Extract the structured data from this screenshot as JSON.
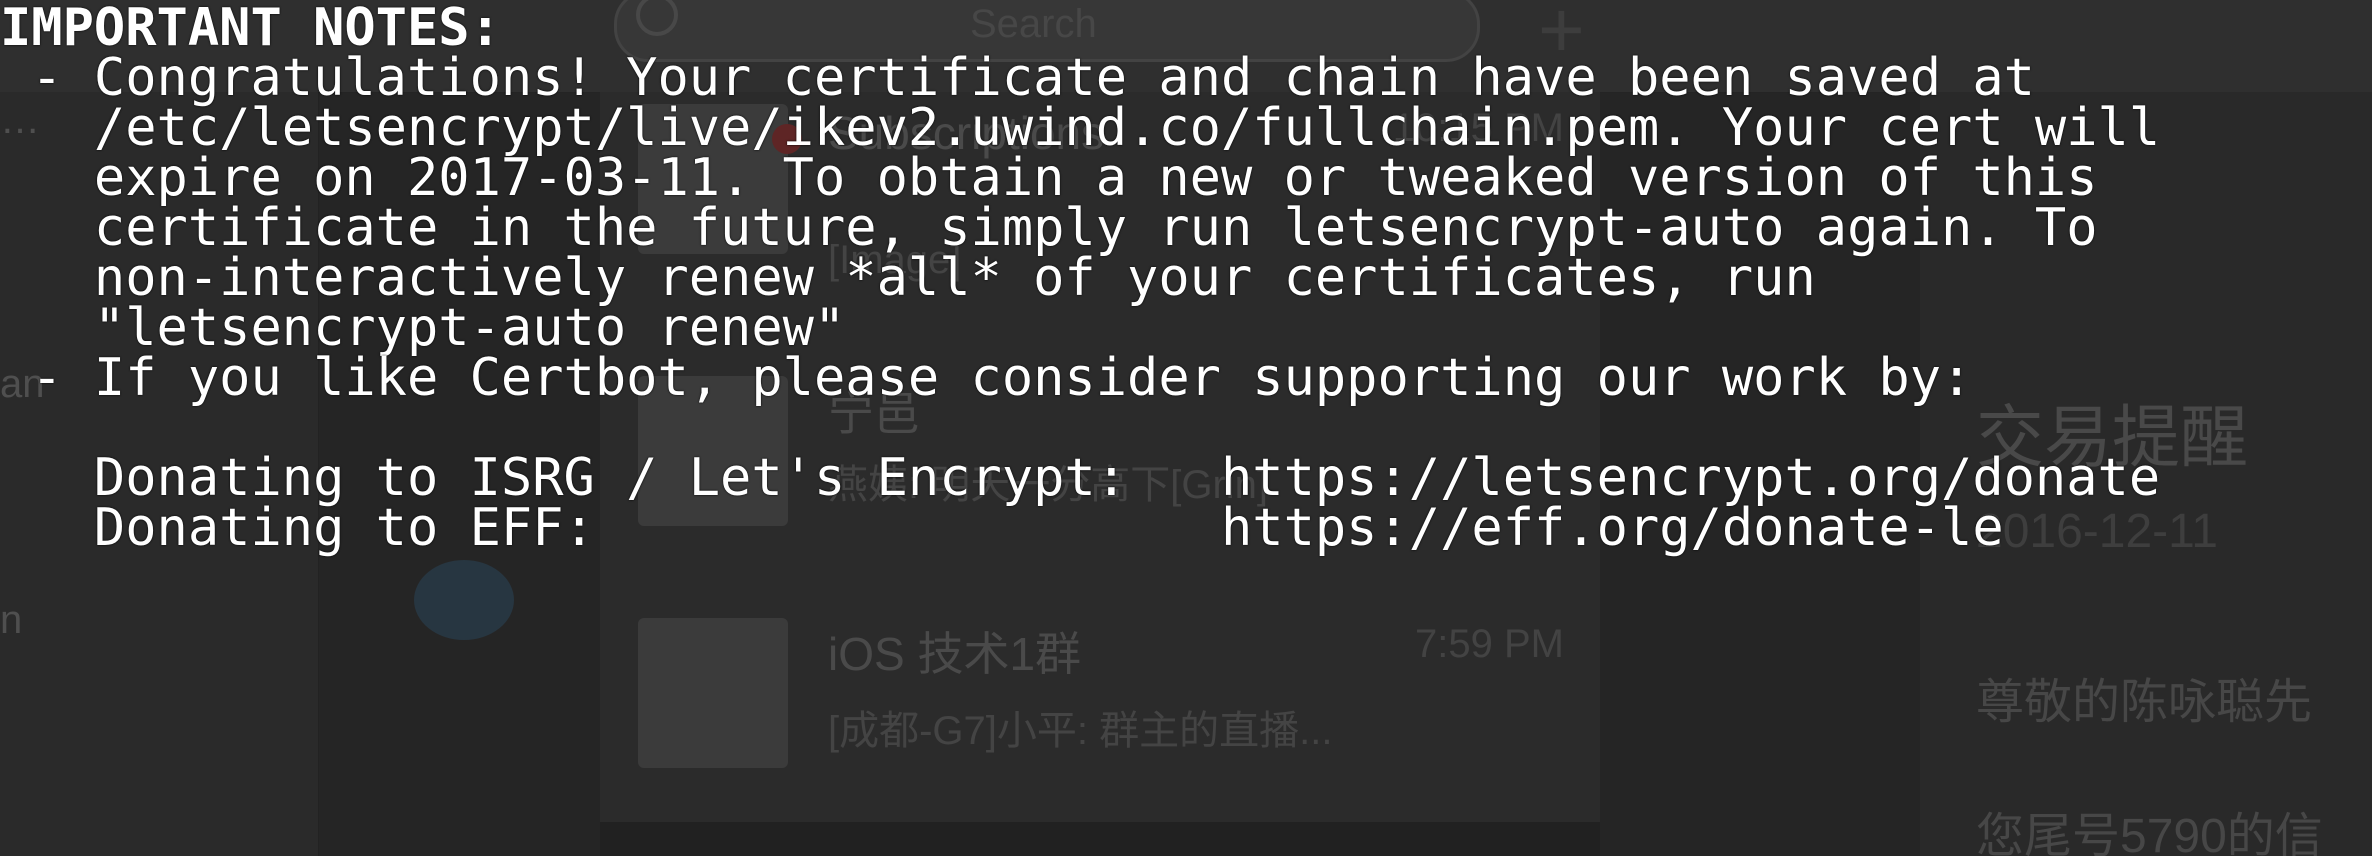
{
  "background_app": {
    "search_placeholder": "Search",
    "add_glyph": "+",
    "sidebar_fragments": [
      "…",
      "an",
      "n"
    ],
    "chat_list": [
      {
        "title": "Subscriptions",
        "subtitle": "",
        "time": "10:15 PM"
      },
      {
        "title": "",
        "subtitle": "[Image]",
        "time": ""
      },
      {
        "title": "宁邑",
        "subtitle": "燕姨: 明天一分高下[Grin]",
        "time": ""
      },
      {
        "title": "iOS 技术1群",
        "subtitle": "[成都-G7]小平: 群主的直播...",
        "time": "7:59 PM"
      }
    ],
    "detail": {
      "title": "交易提醒",
      "date": "2016-12-11",
      "lines": [
        "尊敬的陈咏聪先",
        "您尾号5790的信"
      ]
    },
    "colors": {
      "window_bg": "#2c2c2c",
      "titlebar": "#3a3a3a",
      "text_dim": "#5f5f5f"
    }
  },
  "terminal": {
    "text_color": "#ffffff",
    "header": "IMPORTANT NOTES:",
    "lines": [
      " - Congratulations! Your certificate and chain have been saved at",
      "   /etc/letsencrypt/live/ikev2.uwind.co/fullchain.pem. Your cert will",
      "   expire on 2017-03-11. To obtain a new or tweaked version of this",
      "   certificate in the future, simply run letsencrypt-auto again. To",
      "   non-interactively renew *all* of your certificates, run",
      "   \"letsencrypt-auto renew\"",
      " - If you like Certbot, please consider supporting our work by:",
      "",
      "   Donating to ISRG / Let's Encrypt:   https://letsencrypt.org/donate",
      "   Donating to EFF:                    https://eff.org/donate-le"
    ]
  }
}
